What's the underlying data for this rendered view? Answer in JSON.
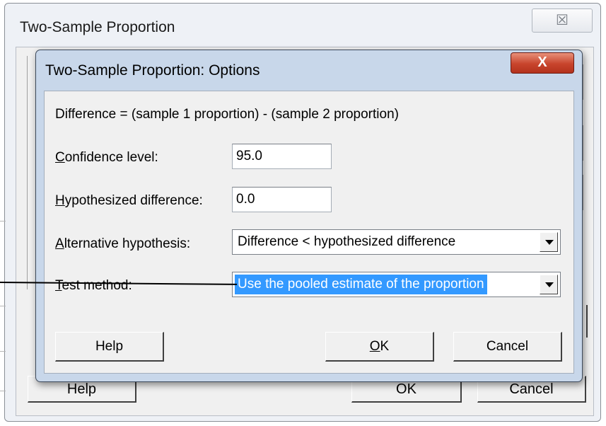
{
  "parent_window": {
    "title": "Two-Sample Proportion",
    "close_glyph": "☒",
    "help_label": "Help",
    "ok_label": "OK",
    "cancel_label": "Cancel"
  },
  "options_dialog": {
    "title": "Two-Sample Proportion: Options",
    "close_glyph": "X",
    "difference_text": "Difference = (sample 1 proportion) - (sample 2 proportion)",
    "confidence_level": {
      "label_underlined": "C",
      "label_rest": "onfidence level:",
      "value": "95.0"
    },
    "hypothesized_difference": {
      "label_underlined": "H",
      "label_rest": "ypothesized difference:",
      "value": "0.0"
    },
    "alternative_hypothesis": {
      "label_underlined": "A",
      "label_rest": "lternative hypothesis:",
      "selected": "Difference < hypothesized difference"
    },
    "test_method": {
      "label_underlined": "T",
      "label_rest": "est method:",
      "selected": "Use the pooled estimate of the proportion"
    },
    "buttons": {
      "help": "Help",
      "ok_underlined": "O",
      "ok_rest": "K",
      "cancel": "Cancel"
    }
  },
  "icons": {
    "close": "close-icon",
    "dropdown": "chevron-down-icon"
  },
  "colors": {
    "selection": "#3399ff",
    "dialog_frame": "#c8d7ea",
    "close_button": "#c8442c"
  }
}
